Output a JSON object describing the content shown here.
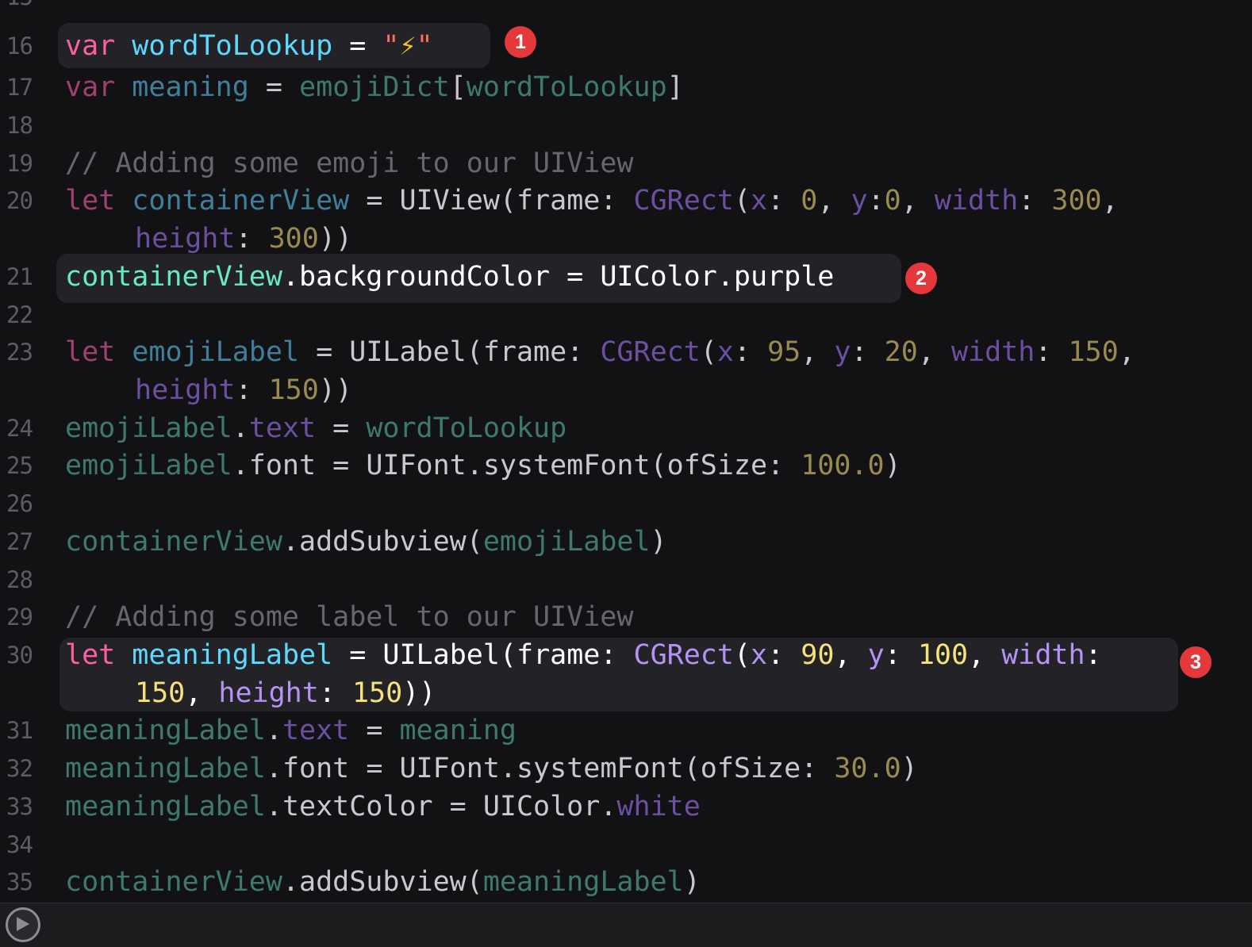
{
  "editor": {
    "partial_top_line": "15",
    "lines": [
      {
        "no": "16",
        "t": [
          "var",
          "wordToLookup",
          "=",
          "\"",
          "⚡",
          "\""
        ]
      },
      {
        "no": "17",
        "t": [
          "var",
          "meaning",
          "=",
          "emojiDict",
          "[",
          "wordToLookup",
          "]"
        ]
      },
      {
        "no": "18"
      },
      {
        "no": "19",
        "t": [
          "// Adding some emoji to our UIView"
        ]
      },
      {
        "no": "20",
        "t": [
          "let",
          "containerView",
          "=",
          "UIView",
          "(frame:",
          "CGRect",
          "(",
          "x",
          ":",
          "0",
          ",",
          "y",
          ":",
          "0",
          ",",
          "width",
          ":",
          "300",
          ","
        ],
        "c": [
          "height",
          ":",
          "300",
          "))"
        ]
      },
      {
        "no": "21",
        "t": [
          "containerView",
          ".backgroundColor",
          "=",
          "UIColor",
          ".purple"
        ]
      },
      {
        "no": "22"
      },
      {
        "no": "23",
        "t": [
          "let",
          "emojiLabel",
          "=",
          "UILabel",
          "(frame:",
          "CGRect",
          "(",
          "x",
          ":",
          "95",
          ",",
          "y",
          ":",
          "20",
          ",",
          "width",
          ":",
          "150",
          ","
        ],
        "c": [
          "height",
          ":",
          "150",
          "))"
        ]
      },
      {
        "no": "24",
        "t": [
          "emojiLabel",
          ".",
          "text",
          "=",
          "wordToLookup"
        ]
      },
      {
        "no": "25",
        "t": [
          "emojiLabel",
          ".font",
          "=",
          "UIFont",
          ".systemFont(ofSize:",
          "100.0",
          ")"
        ]
      },
      {
        "no": "26"
      },
      {
        "no": "27",
        "t": [
          "containerView",
          ".addSubview(",
          "emojiLabel",
          ")"
        ]
      },
      {
        "no": "28"
      },
      {
        "no": "29",
        "t": [
          "// Adding some label to our UIView"
        ]
      },
      {
        "no": "30",
        "t": [
          "let",
          "meaningLabel",
          "=",
          "UILabel",
          "(frame:",
          "CGRect",
          "(",
          "x",
          ":",
          "90",
          ",",
          "y",
          ":",
          "100",
          ",",
          "width",
          ":"
        ],
        "c": [
          "150",
          ",",
          "height",
          ":",
          "150",
          "))"
        ]
      },
      {
        "no": "31",
        "t": [
          "meaningLabel",
          ".",
          "text",
          "=",
          "meaning"
        ]
      },
      {
        "no": "32",
        "t": [
          "meaningLabel",
          ".font",
          "=",
          "UIFont",
          ".systemFont(ofSize:",
          "30.0",
          ")"
        ]
      },
      {
        "no": "33",
        "t": [
          "meaningLabel",
          ".textColor",
          "=",
          "UIColor",
          ".",
          "white"
        ]
      },
      {
        "no": "34"
      },
      {
        "no": "35",
        "t": [
          "containerView",
          ".addSubview(",
          "meaningLabel",
          ")"
        ]
      }
    ]
  },
  "badges": [
    "1",
    "2",
    "3"
  ],
  "toolbar": {
    "run_icon": "play-icon"
  },
  "colors": {
    "background": "#121214",
    "highlight": "#232327",
    "badge": "#e5383b",
    "keyword": "#fc5fa3",
    "identifier": "#5dd8ff",
    "type": "#67e8c7",
    "number": "#f5e27a",
    "param": "#b592f6",
    "comment": "#66666e"
  }
}
